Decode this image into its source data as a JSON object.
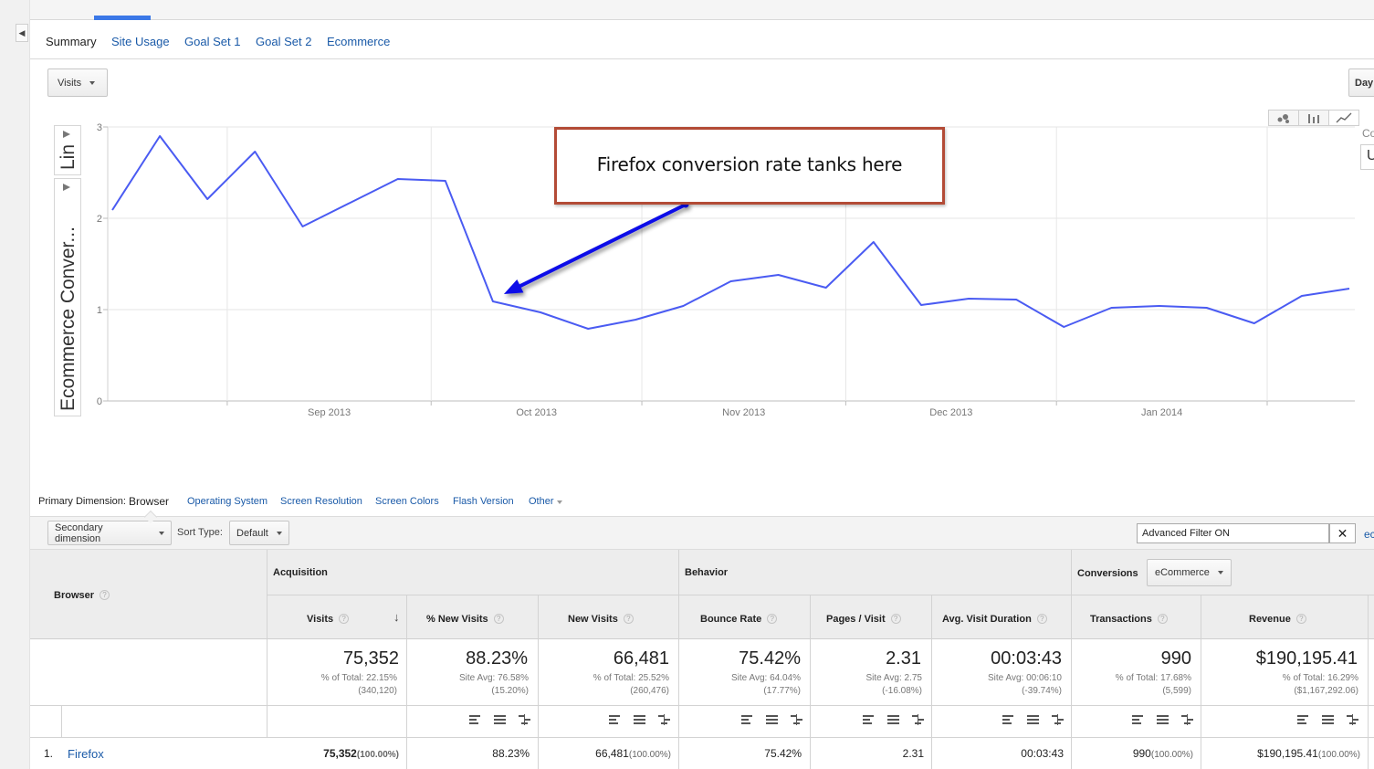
{
  "tabs": [
    "Summary",
    "Site Usage",
    "Goal Set 1",
    "Goal Set 2",
    "Ecommerce"
  ],
  "metric_select": {
    "label": "Visits"
  },
  "interval_button": {
    "label": "Day"
  },
  "edge_snippets": {
    "right_co": "Co",
    "right_box": "U",
    "filter_edge": "ec"
  },
  "axis_selectors": {
    "top": "Lin",
    "bottom": "Ecommerce Conver..."
  },
  "chart_data": {
    "type": "line",
    "ylabel": "Ecommerce Conver...",
    "ylim": [
      0,
      3
    ],
    "y_ticks": [
      "0",
      "1",
      "2",
      "3"
    ],
    "x_ticks": [
      "Sep 2013",
      "Oct 2013",
      "Nov 2013",
      "Dec 2013",
      "Jan 2014"
    ],
    "grid": true,
    "series": [
      {
        "color": "#4a5bf2",
        "x": [
          "2013-08-12",
          "2013-08-19",
          "2013-08-26",
          "2013-09-02",
          "2013-09-09",
          "2013-09-16",
          "2013-09-23",
          "2013-09-30",
          "2013-10-07",
          "2013-10-14",
          "2013-10-21",
          "2013-10-28",
          "2013-11-04",
          "2013-11-11",
          "2013-11-18",
          "2013-11-25",
          "2013-12-02",
          "2013-12-09",
          "2013-12-16",
          "2013-12-23",
          "2013-12-30",
          "2014-01-06",
          "2014-01-13",
          "2014-01-20",
          "2014-01-27",
          "2014-02-03",
          "2014-02-10"
        ],
        "values": [
          2.09,
          2.9,
          2.21,
          2.73,
          1.91,
          2.17,
          2.43,
          2.41,
          1.09,
          0.97,
          0.79,
          0.89,
          1.04,
          1.31,
          1.38,
          1.24,
          1.74,
          1.05,
          1.12,
          1.11,
          0.81,
          1.02,
          1.04,
          1.02,
          0.85,
          1.15,
          1.23
        ]
      }
    ],
    "annotation": {
      "text": "Firefox conversion rate tanks here",
      "points_to": {
        "x": "2013-10-07",
        "y": 1.2
      }
    }
  },
  "dimensions": {
    "label": "Primary Dimension:",
    "current": "Browser",
    "links": [
      "Operating System",
      "Screen Resolution",
      "Screen Colors",
      "Flash Version"
    ],
    "other": "Other"
  },
  "toolbar": {
    "secondary_dimension": "Secondary dimension",
    "sort_type_label": "Sort Type:",
    "sort_type_value": "Default",
    "filter_value": "Advanced Filter ON",
    "clear_label": "✕"
  },
  "table": {
    "row_header": "Browser",
    "groups": {
      "acquisition": "Acquisition",
      "behavior": "Behavior",
      "conversions": "Conversions"
    },
    "conversions_select": "eCommerce",
    "help_glyph": "?",
    "sort_glyph": "↓",
    "columns": [
      {
        "label": "Visits",
        "total": "75,352",
        "sub1": "% of Total: 22.15%",
        "sub2": "(340,120)",
        "row": "75,352",
        "row_pct": "(100.00%)"
      },
      {
        "label": "% New Visits",
        "total": "88.23%",
        "sub1": "Site Avg: 76.58%",
        "sub2": "(15.20%)",
        "row": "88.23%",
        "row_pct": ""
      },
      {
        "label": "New Visits",
        "total": "66,481",
        "sub1": "% of Total: 25.52%",
        "sub2": "(260,476)",
        "row": "66,481",
        "row_pct": "(100.00%)"
      },
      {
        "label": "Bounce Rate",
        "total": "75.42%",
        "sub1": "Site Avg: 64.04%",
        "sub2": "(17.77%)",
        "row": "75.42%",
        "row_pct": ""
      },
      {
        "label": "Pages / Visit",
        "total": "2.31",
        "sub1": "Site Avg: 2.75",
        "sub2": "(-16.08%)",
        "row": "2.31",
        "row_pct": ""
      },
      {
        "label": "Avg. Visit Duration",
        "total": "00:03:43",
        "sub1": "Site Avg: 00:06:10",
        "sub2": "(-39.74%)",
        "row": "00:03:43",
        "row_pct": ""
      },
      {
        "label": "Transactions",
        "total": "990",
        "sub1": "% of Total: 17.68%",
        "sub2": "(5,599)",
        "row": "990",
        "row_pct": "(100.00%)"
      },
      {
        "label": "Revenue",
        "total": "$190,195.41",
        "sub1": "% of Total: 16.29%",
        "sub2": "($1,167,292.06)",
        "row": "$190,195.41",
        "row_pct": "(100.00%)"
      }
    ],
    "rows": [
      {
        "index": "1.",
        "name": "Firefox"
      }
    ]
  }
}
